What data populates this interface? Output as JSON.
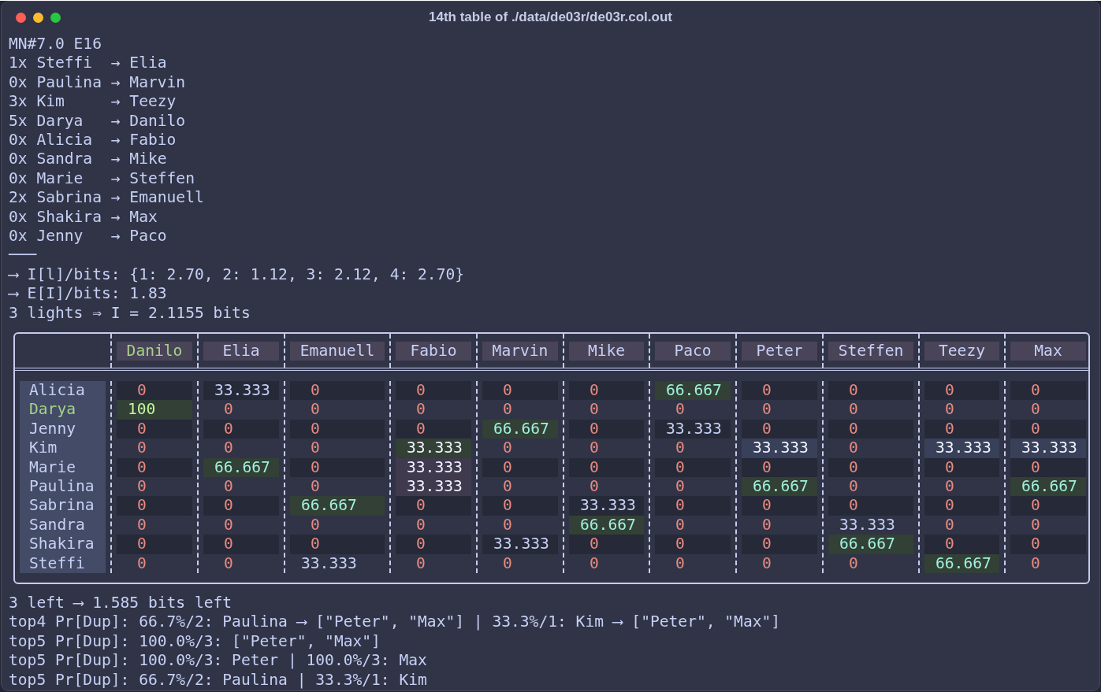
{
  "window": {
    "title": "14th table of ./data/de03r/de03r.col.out"
  },
  "header_lines": [
    "MN#7.0 E16",
    "1x Steffi  → Elia",
    "0x Paulina → Marvin",
    "3x Kim     → Teezy",
    "5x Darya   → Danilo",
    "0x Alicia  → Fabio",
    "0x Sandra  → Mike",
    "0x Marie   → Steffen",
    "2x Sabrina → Emanuell",
    "0x Shakira → Max",
    "0x Jenny   → Paco",
    "───",
    "⟶ I[l]/bits: {1: 2.70, 2: 1.12, 3: 2.12, 4: 2.70}",
    "⟶ E[I]/bits: 1.83",
    "3 lights ⇒ I = 2.1155 bits"
  ],
  "table": {
    "columns": [
      {
        "label": "Danilo",
        "highlighted": true
      },
      {
        "label": "Elia",
        "highlighted": false
      },
      {
        "label": "Emanuell",
        "highlighted": false
      },
      {
        "label": "Fabio",
        "highlighted": false
      },
      {
        "label": "Marvin",
        "highlighted": false
      },
      {
        "label": "Mike",
        "highlighted": false
      },
      {
        "label": "Paco",
        "highlighted": false
      },
      {
        "label": "Peter",
        "highlighted": false
      },
      {
        "label": "Steffen",
        "highlighted": false
      },
      {
        "label": "Teezy",
        "highlighted": false
      },
      {
        "label": "Max",
        "highlighted": false
      }
    ],
    "rows": [
      {
        "label": "Alicia",
        "highlighted": false,
        "cells": [
          {
            "value": "0",
            "kind": "zero"
          },
          {
            "value": "33.333",
            "kind": "plain"
          },
          {
            "value": "0",
            "kind": "zero"
          },
          {
            "value": "0",
            "kind": "zero"
          },
          {
            "value": "0",
            "kind": "zero"
          },
          {
            "value": "0",
            "kind": "zero"
          },
          {
            "value": "66.667",
            "kind": "match"
          },
          {
            "value": "0",
            "kind": "zero"
          },
          {
            "value": "0",
            "kind": "zero"
          },
          {
            "value": "0",
            "kind": "zero"
          },
          {
            "value": "0",
            "kind": "zero"
          }
        ]
      },
      {
        "label": "Darya",
        "highlighted": true,
        "cells": [
          {
            "value": "100",
            "kind": "exact"
          },
          {
            "value": "0",
            "kind": "zero"
          },
          {
            "value": "0",
            "kind": "zero"
          },
          {
            "value": "0",
            "kind": "zero"
          },
          {
            "value": "0",
            "kind": "zero"
          },
          {
            "value": "0",
            "kind": "zero"
          },
          {
            "value": "0",
            "kind": "zero"
          },
          {
            "value": "0",
            "kind": "zero"
          },
          {
            "value": "0",
            "kind": "zero"
          },
          {
            "value": "0",
            "kind": "zero"
          },
          {
            "value": "0",
            "kind": "zero"
          }
        ]
      },
      {
        "label": "Jenny",
        "highlighted": false,
        "cells": [
          {
            "value": "0",
            "kind": "zero"
          },
          {
            "value": "0",
            "kind": "zero"
          },
          {
            "value": "0",
            "kind": "zero"
          },
          {
            "value": "0",
            "kind": "zero"
          },
          {
            "value": "66.667",
            "kind": "match"
          },
          {
            "value": "0",
            "kind": "zero"
          },
          {
            "value": "33.333",
            "kind": "plain"
          },
          {
            "value": "0",
            "kind": "zero"
          },
          {
            "value": "0",
            "kind": "zero"
          },
          {
            "value": "0",
            "kind": "zero"
          },
          {
            "value": "0",
            "kind": "zero"
          }
        ]
      },
      {
        "label": "Kim",
        "highlighted": false,
        "cells": [
          {
            "value": "0",
            "kind": "zero"
          },
          {
            "value": "0",
            "kind": "zero"
          },
          {
            "value": "0",
            "kind": "zero"
          },
          {
            "value": "33.333",
            "kind": "partial"
          },
          {
            "value": "0",
            "kind": "zero"
          },
          {
            "value": "0",
            "kind": "zero"
          },
          {
            "value": "0",
            "kind": "zero"
          },
          {
            "value": "33.333",
            "kind": "candidate"
          },
          {
            "value": "0",
            "kind": "zero"
          },
          {
            "value": "33.333",
            "kind": "candidate"
          },
          {
            "value": "33.333",
            "kind": "candidate"
          }
        ]
      },
      {
        "label": "Marie",
        "highlighted": false,
        "cells": [
          {
            "value": "0",
            "kind": "zero"
          },
          {
            "value": "66.667",
            "kind": "match"
          },
          {
            "value": "0",
            "kind": "zero"
          },
          {
            "value": "33.333",
            "kind": "guess"
          },
          {
            "value": "0",
            "kind": "zero"
          },
          {
            "value": "0",
            "kind": "zero"
          },
          {
            "value": "0",
            "kind": "zero"
          },
          {
            "value": "0",
            "kind": "zero"
          },
          {
            "value": "0",
            "kind": "zero"
          },
          {
            "value": "0",
            "kind": "zero"
          },
          {
            "value": "0",
            "kind": "zero"
          }
        ]
      },
      {
        "label": "Paulina",
        "highlighted": false,
        "cells": [
          {
            "value": "0",
            "kind": "zero"
          },
          {
            "value": "0",
            "kind": "zero"
          },
          {
            "value": "0",
            "kind": "zero"
          },
          {
            "value": "33.333",
            "kind": "guess"
          },
          {
            "value": "0",
            "kind": "zero"
          },
          {
            "value": "0",
            "kind": "zero"
          },
          {
            "value": "0",
            "kind": "zero"
          },
          {
            "value": "66.667",
            "kind": "match"
          },
          {
            "value": "0",
            "kind": "zero"
          },
          {
            "value": "0",
            "kind": "zero"
          },
          {
            "value": "66.667",
            "kind": "match"
          }
        ]
      },
      {
        "label": "Sabrina",
        "highlighted": false,
        "cells": [
          {
            "value": "0",
            "kind": "zero"
          },
          {
            "value": "0",
            "kind": "zero"
          },
          {
            "value": "66.667",
            "kind": "match"
          },
          {
            "value": "0",
            "kind": "zero"
          },
          {
            "value": "0",
            "kind": "zero"
          },
          {
            "value": "33.333",
            "kind": "plain"
          },
          {
            "value": "0",
            "kind": "zero"
          },
          {
            "value": "0",
            "kind": "zero"
          },
          {
            "value": "0",
            "kind": "zero"
          },
          {
            "value": "0",
            "kind": "zero"
          },
          {
            "value": "0",
            "kind": "zero"
          }
        ]
      },
      {
        "label": "Sandra",
        "highlighted": false,
        "cells": [
          {
            "value": "0",
            "kind": "zero"
          },
          {
            "value": "0",
            "kind": "zero"
          },
          {
            "value": "0",
            "kind": "zero"
          },
          {
            "value": "0",
            "kind": "zero"
          },
          {
            "value": "0",
            "kind": "zero"
          },
          {
            "value": "66.667",
            "kind": "match"
          },
          {
            "value": "0",
            "kind": "zero"
          },
          {
            "value": "0",
            "kind": "zero"
          },
          {
            "value": "33.333",
            "kind": "plain"
          },
          {
            "value": "0",
            "kind": "zero"
          },
          {
            "value": "0",
            "kind": "zero"
          }
        ]
      },
      {
        "label": "Shakira",
        "highlighted": false,
        "cells": [
          {
            "value": "0",
            "kind": "zero"
          },
          {
            "value": "0",
            "kind": "zero"
          },
          {
            "value": "0",
            "kind": "zero"
          },
          {
            "value": "0",
            "kind": "zero"
          },
          {
            "value": "33.333",
            "kind": "plain"
          },
          {
            "value": "0",
            "kind": "zero"
          },
          {
            "value": "0",
            "kind": "zero"
          },
          {
            "value": "0",
            "kind": "zero"
          },
          {
            "value": "66.667",
            "kind": "match"
          },
          {
            "value": "0",
            "kind": "zero"
          },
          {
            "value": "0",
            "kind": "zero"
          }
        ]
      },
      {
        "label": "Steffi",
        "highlighted": false,
        "cells": [
          {
            "value": "0",
            "kind": "zero"
          },
          {
            "value": "0",
            "kind": "zero"
          },
          {
            "value": "33.333",
            "kind": "plain"
          },
          {
            "value": "0",
            "kind": "zero"
          },
          {
            "value": "0",
            "kind": "zero"
          },
          {
            "value": "0",
            "kind": "zero"
          },
          {
            "value": "0",
            "kind": "zero"
          },
          {
            "value": "0",
            "kind": "zero"
          },
          {
            "value": "0",
            "kind": "zero"
          },
          {
            "value": "66.667",
            "kind": "match"
          },
          {
            "value": "0",
            "kind": "zero"
          }
        ]
      }
    ]
  },
  "footer_lines": [
    "3 left ⟶ 1.585 bits left",
    "top4 Pr[Dup]: 66.7%/2: Paulina ⟶ [\"Peter\", \"Max\"] | 33.3%/1: Kim ⟶ [\"Peter\", \"Max\"]",
    "top5 Pr[Dup]: 100.0%/3: [\"Peter\", \"Max\"]",
    "top5 Pr[Dup]: 100.0%/3: Peter | 100.0%/3: Max",
    "top5 Pr[Dup]: 66.7%/2: Paulina | 33.3%/1: Kim"
  ]
}
